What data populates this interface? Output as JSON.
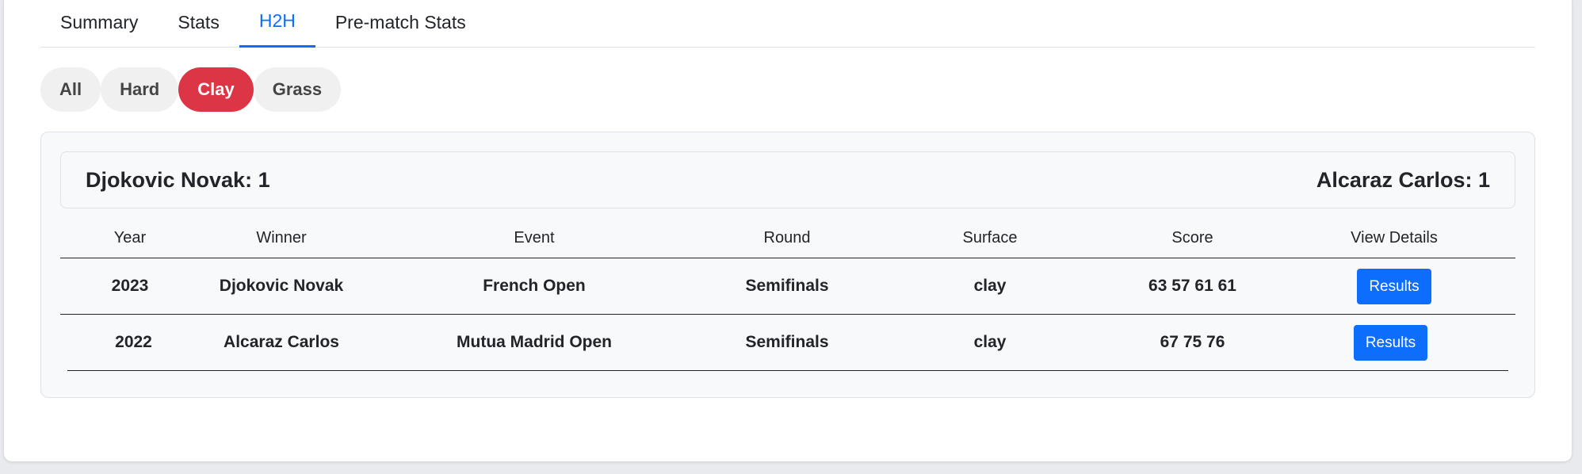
{
  "tabs": [
    {
      "label": "Summary",
      "active": false
    },
    {
      "label": "Stats",
      "active": false
    },
    {
      "label": "H2H",
      "active": true
    },
    {
      "label": "Pre-match Stats",
      "active": false
    }
  ],
  "surface_filters": [
    {
      "label": "All",
      "active": false
    },
    {
      "label": "Hard",
      "active": false
    },
    {
      "label": "Clay",
      "active": true
    },
    {
      "label": "Grass",
      "active": false
    }
  ],
  "h2h_summary": {
    "player1": "Djokovic Novak: 1",
    "player2": "Alcaraz Carlos: 1"
  },
  "table": {
    "columns": [
      "Year",
      "Winner",
      "Event",
      "Round",
      "Surface",
      "Score",
      "View Details"
    ],
    "rows": [
      {
        "year": "2023",
        "winner": "Djokovic Novak",
        "event": "French Open",
        "round": "Semifinals",
        "surface": "clay",
        "score": "63 57 61 61",
        "action": "Results"
      },
      {
        "year": "2022",
        "winner": "Alcaraz Carlos",
        "event": "Mutua Madrid Open",
        "round": "Semifinals",
        "surface": "clay",
        "score": "67 75 76",
        "action": "Results"
      }
    ]
  },
  "colors": {
    "accent_blue": "#0d6efd",
    "active_filter_red": "#dc3545",
    "filter_bg": "#f0f0f0",
    "panel_bg": "#f8f9fa"
  }
}
